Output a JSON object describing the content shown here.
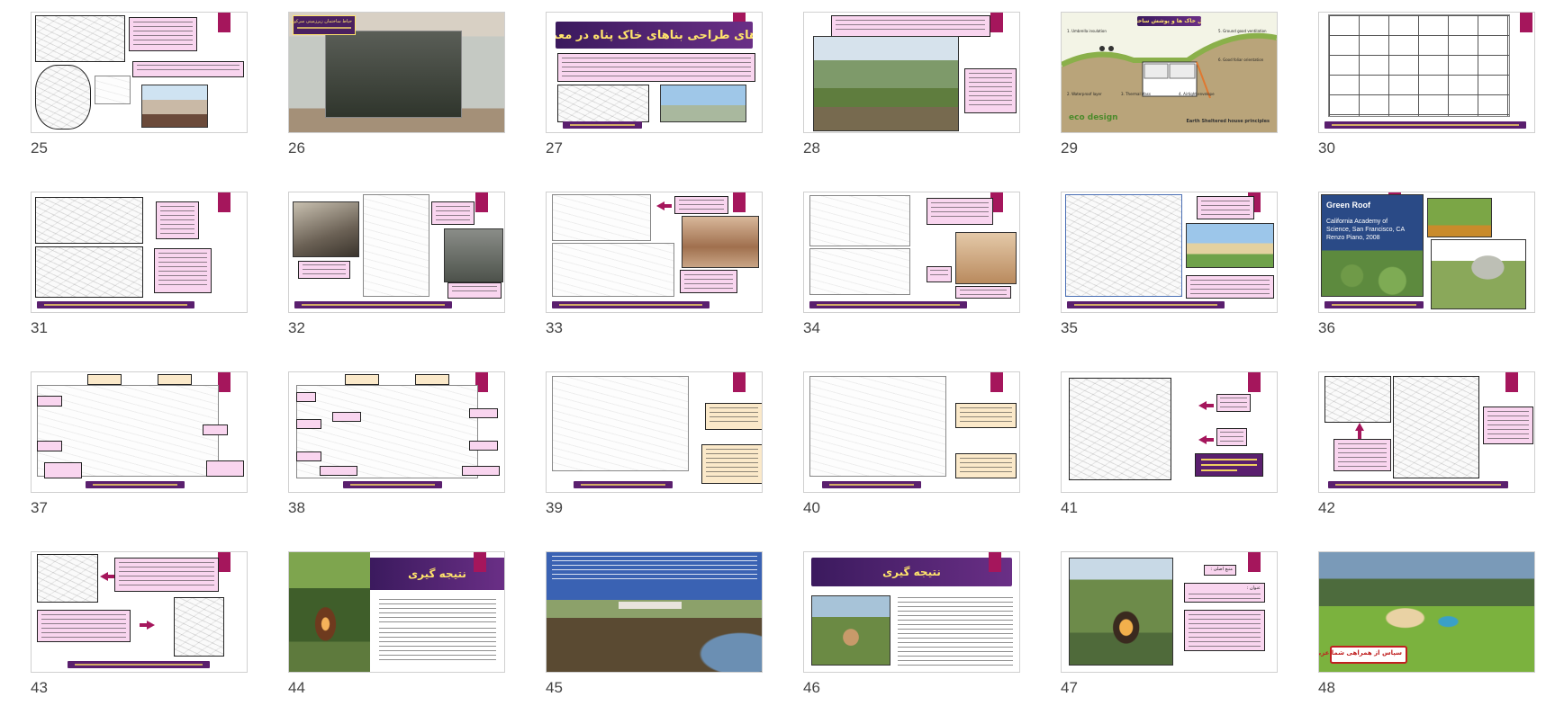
{
  "app": {
    "view": "slide-sorter"
  },
  "slides": [
    {
      "number": "25"
    },
    {
      "number": "26",
      "caption": "حیاط ساختمان زیرزمینی سرکوپ"
    },
    {
      "number": "27",
      "title": "الگوهای طراحی بناهای خاک پناه در معماری"
    },
    {
      "number": "28"
    },
    {
      "number": "29",
      "title": "اصول خاک ها و پوشش ساختمان",
      "diagram_labels": [
        "1. Umbrella insulation",
        "2. Waterproof layer",
        "3. Thermal Mass",
        "4. Airtight envelope",
        "5. Ground good ventilation",
        "6. Good foliar orientation"
      ],
      "brand": "eco design",
      "footer": "Earth Sheltered house principles"
    },
    {
      "number": "30"
    },
    {
      "number": "31"
    },
    {
      "number": "32"
    },
    {
      "number": "33"
    },
    {
      "number": "34"
    },
    {
      "number": "35"
    },
    {
      "number": "36",
      "heading": "Green Roof",
      "subtext": [
        "California Academy of",
        "Science, San Francisco, CA",
        "Renzo Piano, 2008"
      ]
    },
    {
      "number": "37"
    },
    {
      "number": "38"
    },
    {
      "number": "39"
    },
    {
      "number": "40"
    },
    {
      "number": "41"
    },
    {
      "number": "42"
    },
    {
      "number": "43"
    },
    {
      "number": "44",
      "title": "نتیجه گیری"
    },
    {
      "number": "45"
    },
    {
      "number": "46",
      "title": "نتیجه گیری"
    },
    {
      "number": "47",
      "boxes": [
        "منبع اصلی :",
        "عنوان :"
      ]
    },
    {
      "number": "48",
      "caption": "سپاس از همراهی شما عزیزان"
    }
  ],
  "colors": {
    "title_gradient_start": "#3b1a5e",
    "title_gradient_end": "#6a2f86",
    "title_text": "#ffe46b",
    "accent": "#a5165c",
    "pink_box": "#f9d5ef",
    "cream_box": "#fbe9c9",
    "footer_bar": "#5a1f6e"
  }
}
